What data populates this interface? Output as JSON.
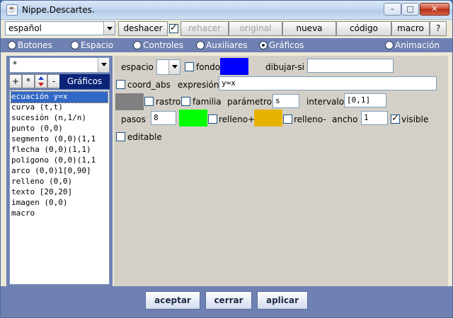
{
  "window": {
    "title": "Nippe.Descartes."
  },
  "toolbar": {
    "language": "español",
    "undo": "deshacer",
    "redo": "rehacer",
    "original": "original",
    "new": "nueva",
    "code": "código",
    "macro": "macro",
    "help": "?"
  },
  "tabs": [
    {
      "label": "Botones",
      "selected": false
    },
    {
      "label": "Espacio",
      "selected": false
    },
    {
      "label": "Controles",
      "selected": false
    },
    {
      "label": "Auxiliares",
      "selected": false
    },
    {
      "label": "Gráficos",
      "selected": true
    },
    {
      "label": "Animación",
      "selected": false
    }
  ],
  "left": {
    "filter_value": "*",
    "add": "+",
    "star": "*",
    "remove": "-",
    "section_button": "Gráficos",
    "items": [
      "ecuación y=x",
      "curva (t,t)",
      "sucesión (n,1/n)",
      "punto (0,0)",
      "segmento (0,0)(1,1",
      "flecha (0,0)(1,1)",
      "polígono (0,0)(1,1",
      "arco (0,0)1[0,90]",
      "relleno (0,0)",
      "texto [20,20]",
      "imagen (0,0)",
      "macro"
    ],
    "selected_index": 0
  },
  "props": {
    "espacio_label": "espacio",
    "fondo_label": "fondo",
    "dibujar_si_label": "dibujar-si",
    "dibujar_si_value": "",
    "coord_abs_label": "coord_abs",
    "expresion_label": "expresión",
    "expresion_value": "y=x",
    "rastro_label": "rastro",
    "familia_label": "familia",
    "parametro_label": "parámetro",
    "parametro_value": "s",
    "intervalo_label": "intervalo",
    "intervalo_value": "[0,1]",
    "pasos_label": "pasos",
    "pasos_value": "8",
    "relleno_plus_label": "relleno+",
    "relleno_minus_label": "relleno-",
    "ancho_label": "ancho",
    "ancho_value": "1",
    "visible_label": "visible",
    "editable_label": "editable",
    "colors": {
      "fondo": "#0000ff",
      "rastro": "#808080",
      "relleno_plus": "#00ff00",
      "relleno_minus": "#e6b400"
    }
  },
  "bottom": {
    "accept": "aceptar",
    "close": "cerrar",
    "apply": "aplicar"
  }
}
